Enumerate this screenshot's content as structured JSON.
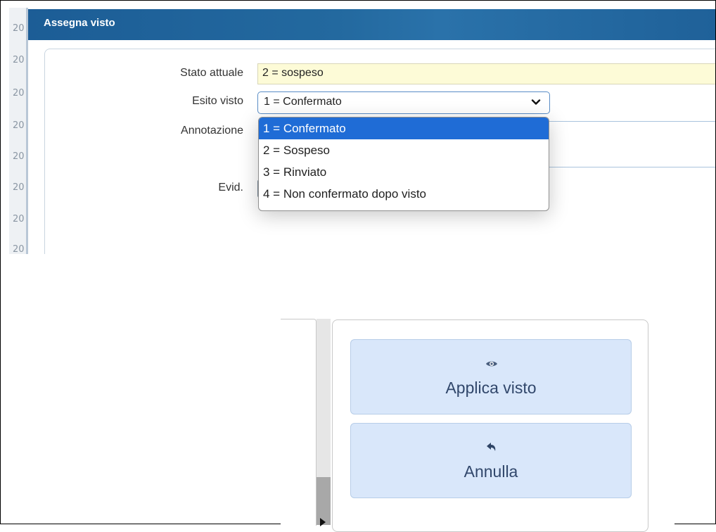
{
  "dialog": {
    "title": "Assegna visto",
    "gutter_numbers": [
      "20",
      "20",
      "20",
      "20",
      "20",
      "20",
      "20",
      "20"
    ]
  },
  "form": {
    "stato_attuale_label": "Stato attuale",
    "stato_attuale_value": "2 = sospeso",
    "esito_visto_label": "Esito visto",
    "esito_visto_value": "1 = Confermato",
    "annotazione_label": "Annotazione",
    "evid_label": "Evid."
  },
  "dropdown": {
    "options": [
      "1 = Confermato",
      "2 = Sospeso",
      "3 = Rinviato",
      "4 = Non confermato dopo visto"
    ],
    "selected_index": 0
  },
  "actions": {
    "apply_label": "Applica visto",
    "apply_icon": "eye-icon",
    "cancel_label": "Annulla",
    "cancel_icon": "undo-arrow-icon"
  },
  "colors": {
    "title_bar": "#1f6199",
    "selected_option": "#1f6cd6",
    "button_bg": "#d9e7fa",
    "button_text": "#31476b",
    "stato_bg": "#fdfbd7"
  }
}
